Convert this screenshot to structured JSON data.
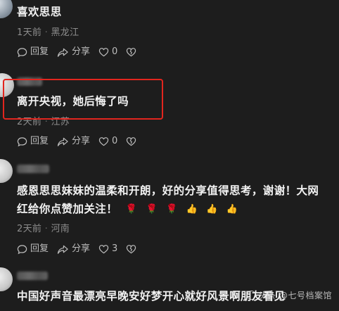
{
  "comments": [
    {
      "text": "喜欢思思",
      "time": "1天前",
      "sep": "·",
      "location": "黑龙江",
      "reply_label": "回复",
      "share_label": "分享",
      "likes": "0"
    },
    {
      "text": "离开央视，她后悔了吗",
      "time": "2天前",
      "sep": "·",
      "location": "江苏",
      "reply_label": "回复",
      "share_label": "分享",
      "likes": "0"
    },
    {
      "text_line1": "感恩思思妹妹的温柔和开朗，好的分享值得思考，谢谢！大网",
      "text_line2": "红给你点赞加关注！",
      "emojis": [
        "🌹",
        "🌹",
        "🌹",
        "👍",
        "👍",
        "👍"
      ],
      "time": "2天前",
      "sep": "·",
      "location": "河南",
      "reply_label": "回复",
      "share_label": "分享",
      "likes": "3"
    },
    {
      "text": "中国好声音最漂亮早晚安好梦开心就好风景啊朋友看见"
    }
  ],
  "watermark": {
    "text": "头条 @七号档案馆"
  },
  "colors": {
    "background": "#1d1d1d",
    "highlight_box": "#e2251e",
    "meta_text": "#8d8d8d"
  }
}
